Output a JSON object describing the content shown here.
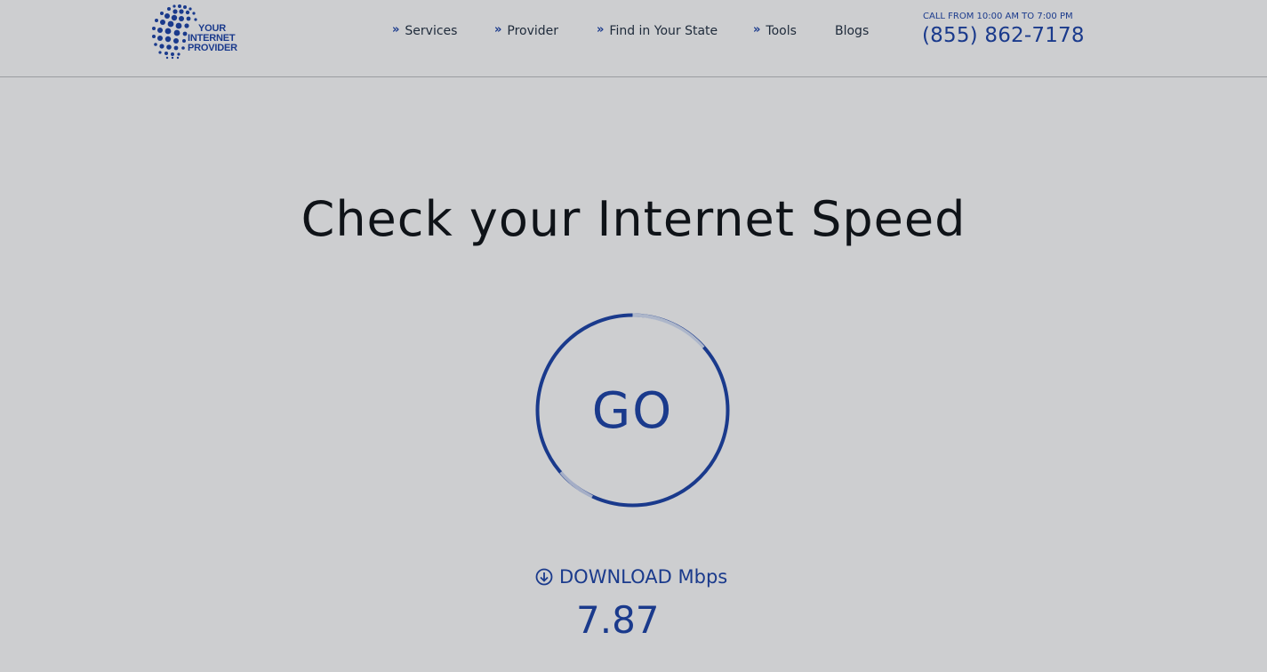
{
  "logo": {
    "line1": "YOUR",
    "line2": "INTERNET",
    "line3": "PROVIDER",
    "icon": "globe-dots-icon",
    "color": "#1a3a8c"
  },
  "nav": {
    "items": [
      {
        "label": "Services",
        "has_chevron": true
      },
      {
        "label": "Provider",
        "has_chevron": true
      },
      {
        "label": "Find in Your State",
        "has_chevron": true
      },
      {
        "label": "Tools",
        "has_chevron": true
      },
      {
        "label": "Blogs",
        "has_chevron": false
      }
    ],
    "chevron_glyph": "»"
  },
  "contact": {
    "hours": "CALL FROM 10:00 AM TO 7:00 PM",
    "phone": "(855) 862-7178"
  },
  "main": {
    "title": "Check your Internet Speed",
    "go_button": "GO",
    "download_label": "DOWNLOAD Mbps",
    "download_icon": "download-circle-icon",
    "download_value": "7.87"
  },
  "colors": {
    "accent": "#1a3a8c",
    "background": "#cdced0",
    "text": "#0f1318"
  }
}
